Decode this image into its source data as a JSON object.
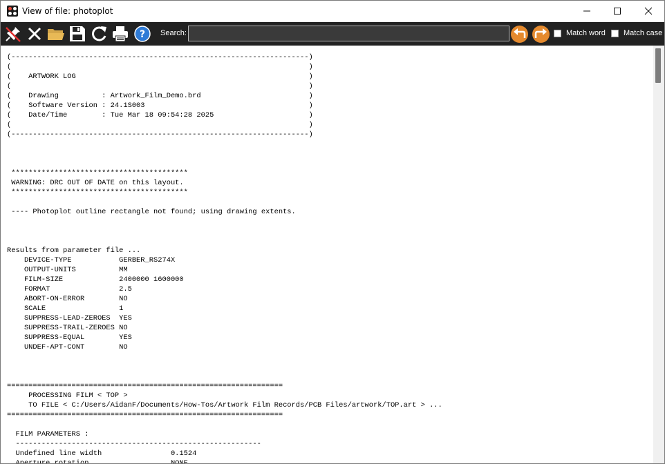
{
  "window": {
    "title": "View of file: photoplot",
    "minimize_glyph": "—",
    "maximize_glyph": "☐",
    "close_glyph": "✕"
  },
  "toolbar": {
    "buttons": [
      {
        "name": "pin-off-icon",
        "tooltip": ""
      },
      {
        "name": "close-icon",
        "tooltip": ""
      },
      {
        "name": "folder-open-icon",
        "tooltip": ""
      },
      {
        "name": "save-icon",
        "tooltip": ""
      },
      {
        "name": "refresh-icon",
        "tooltip": ""
      },
      {
        "name": "print-icon",
        "tooltip": ""
      },
      {
        "name": "help-icon",
        "tooltip": ""
      }
    ],
    "search_label": "Search:",
    "search_value": "",
    "search_placeholder": "",
    "match_word_label": "Match word",
    "match_case_label": "Match case",
    "match_word_checked": false,
    "match_case_checked": false,
    "accent_color": "#e58a2e",
    "background_color": "#222222"
  },
  "log_lines": [
    "(---------------------------------------------------------------------)",
    "(                                                                     )",
    "(    ARTWORK LOG                                                      )",
    "(                                                                     )",
    "(    Drawing          : Artwork_Film_Demo.brd                         )",
    "(    Software Version : 24.1S003                                      )",
    "(    Date/Time        : Tue Mar 18 09:54:28 2025                      )",
    "(                                                                     )",
    "(---------------------------------------------------------------------)",
    "",
    "",
    "",
    " *****************************************",
    " WARNING: DRC OUT OF DATE on this layout.",
    " *****************************************",
    "",
    " ---- Photoplot outline rectangle not found; using drawing extents.",
    "",
    "",
    "",
    "Results from parameter file ...",
    "    DEVICE-TYPE           GERBER_RS274X",
    "    OUTPUT-UNITS          MM",
    "    FILM-SIZE             2400000 1600000",
    "    FORMAT                2.5",
    "    ABORT-ON-ERROR        NO",
    "    SCALE                 1",
    "    SUPPRESS-LEAD-ZEROES  YES",
    "    SUPPRESS-TRAIL-ZEROES NO",
    "    SUPPRESS-EQUAL        YES",
    "    UNDEF-APT-CONT        NO",
    "",
    "",
    "",
    "================================================================",
    "     PROCESSING FILM < TOP >",
    "     TO FILE < C:/Users/AidanF/Documents/How-Tos/Artwork Film Records/PCB Files/artwork/TOP.art > ...",
    "================================================================",
    "",
    "  FILM PARAMETERS :",
    "  ---------------------------------------------------------",
    "  Undefined line width                0.1524",
    "  Aperture rotation                   NONE"
  ]
}
